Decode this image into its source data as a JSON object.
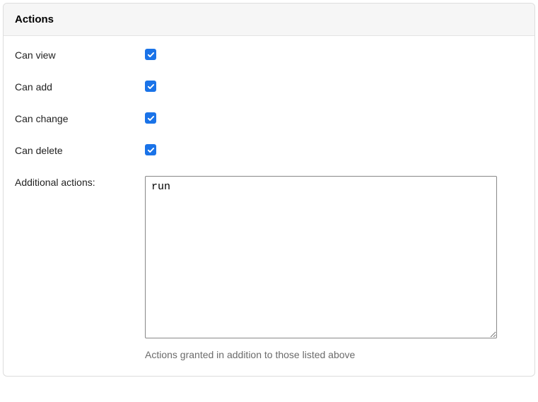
{
  "panel": {
    "title": "Actions"
  },
  "form": {
    "can_view": {
      "label": "Can view",
      "checked": true
    },
    "can_add": {
      "label": "Can add",
      "checked": true
    },
    "can_change": {
      "label": "Can change",
      "checked": true
    },
    "can_delete": {
      "label": "Can delete",
      "checked": true
    },
    "additional": {
      "label": "Additional actions:",
      "value": "run",
      "help": "Actions granted in addition to those listed above"
    }
  }
}
